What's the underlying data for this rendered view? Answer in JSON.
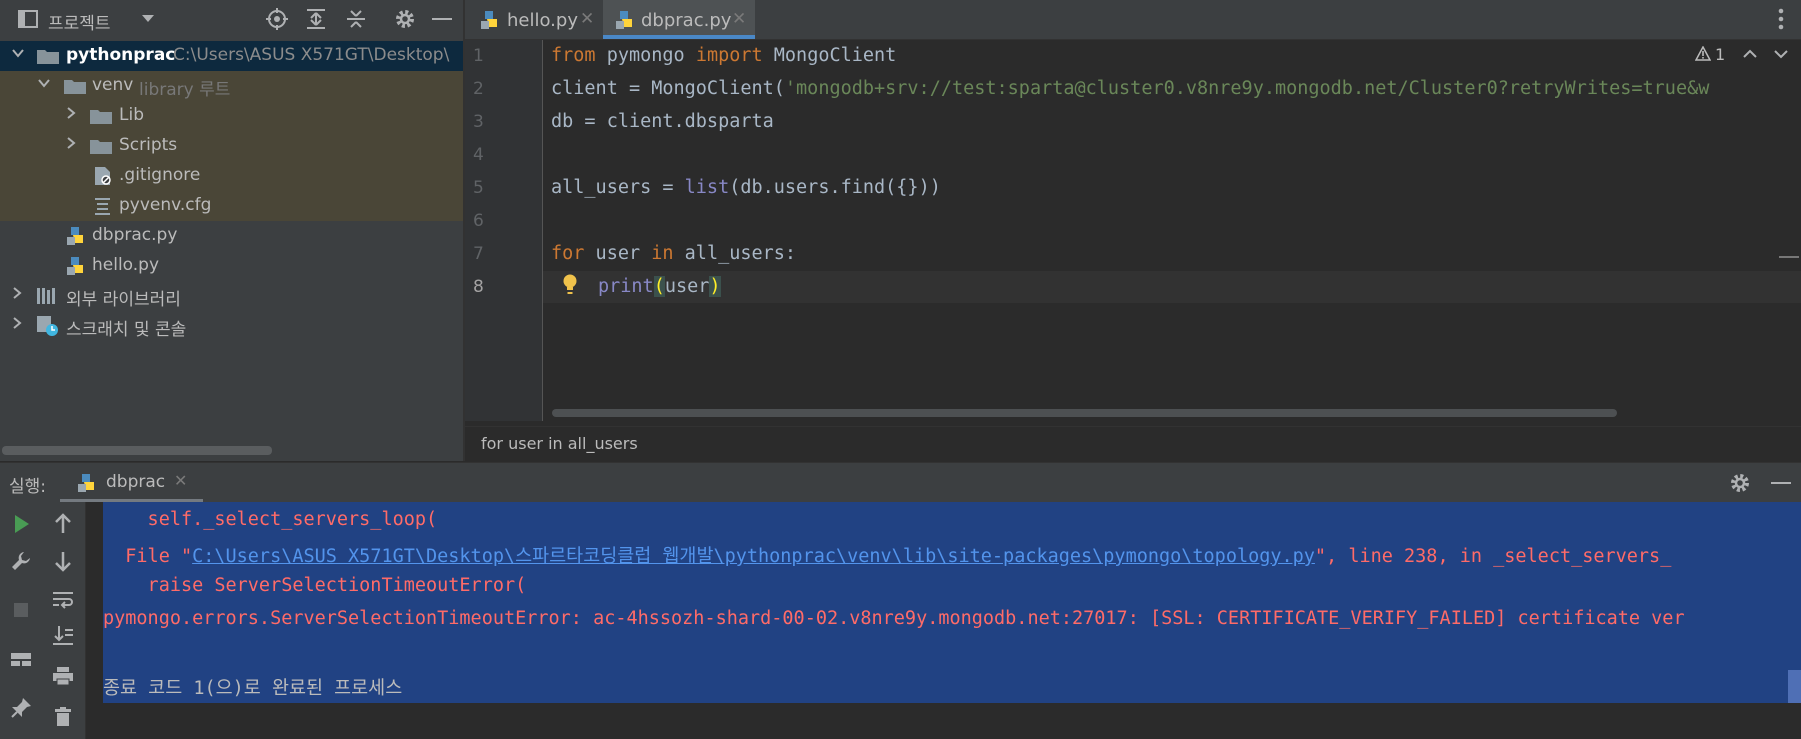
{
  "project_panel": {
    "title": "프로젝트",
    "tree": [
      {
        "label": "pythonprac",
        "path": "C:\\Users\\ASUS X571GT\\Desktop\\"
      },
      {
        "label": "venv",
        "note": "library 루트"
      },
      {
        "label": "Lib"
      },
      {
        "label": "Scripts"
      },
      {
        "label": ".gitignore"
      },
      {
        "label": "pyvenv.cfg"
      },
      {
        "label": "dbprac.py"
      },
      {
        "label": "hello.py"
      },
      {
        "label": "외부 라이브러리"
      },
      {
        "label": "스크래치 및 콘솔"
      }
    ]
  },
  "editor": {
    "tabs": [
      {
        "label": "hello.py",
        "active": false
      },
      {
        "label": "dbprac.py",
        "active": true
      }
    ],
    "warning_count": "1",
    "line_numbers": [
      "1",
      "2",
      "3",
      "4",
      "5",
      "6",
      "7",
      "8"
    ],
    "code": {
      "l1_kw1": "from",
      "l1_mid": " pymongo ",
      "l1_kw2": "import",
      "l1_end": " MongoClient",
      "l2_pre": "client = MongoClient(",
      "l2_str": "'mongodb+srv://test:sparta@cluster0.v8nre9y.mongodb.net/Cluster0?retryWrites=true&w",
      "l3": "db = client.dbsparta",
      "l5_pre": "all_users = ",
      "l5_bi": "list",
      "l5_post": "(db.users.find({}))",
      "l7_kw1": "for",
      "l7_mid": " user ",
      "l7_kw2": "in",
      "l7_end": " all_users:",
      "l8_bi": "print",
      "l8_open": "(",
      "l8_arg": "user",
      "l8_close": ")"
    },
    "breadcrumb": "for user in all_users"
  },
  "run_panel": {
    "label": "실행:",
    "tab": "dbprac",
    "console": {
      "line1": "    self._select_servers_loop(",
      "line2_pre": "  File \"",
      "line2_link": "C:\\Users\\ASUS X571GT\\Desktop\\스파르타코딩클럽 웹개발\\pythonprac\\venv\\lib\\site-packages\\pymongo\\topology.py",
      "line2_post": "\", line 238, in _select_servers_",
      "line3": "    raise ServerSelectionTimeoutError(",
      "line4": "pymongo.errors.ServerSelectionTimeoutError: ac-4hssozh-shard-00-02.v8nre9y.mongodb.net:27017: [SSL: CERTIFICATE_VERIFY_FAILED] certificate ver",
      "line5": "종료 코드 1(으)로 완료된 프로세스"
    }
  },
  "colors": {
    "accent": "#4a88c7",
    "keyword": "#cc7832",
    "string": "#6a8759",
    "error": "#ff6b68",
    "selection": "#214283"
  }
}
